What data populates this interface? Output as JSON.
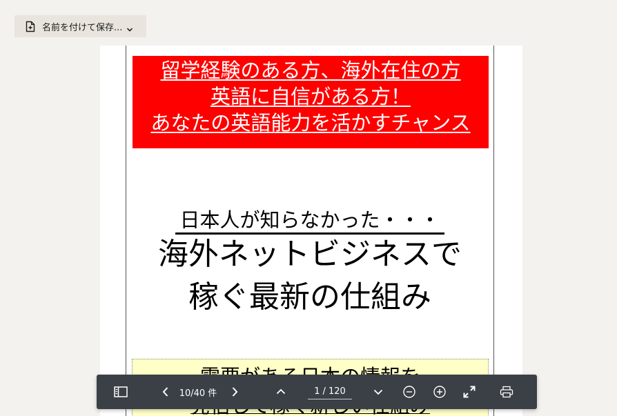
{
  "save_button": {
    "label": "名前を付けて保存...",
    "icon": "document-add-icon",
    "chevron_icon": "chevron-down-icon"
  },
  "document": {
    "red_banner": {
      "lines": [
        "留学経験のある方、海外在住の方",
        "英語に自信がある方！",
        "あなたの英語能力を活かすチャンス"
      ],
      "background": "#ff0000",
      "text_color": "#ffffff"
    },
    "intro": "日本人が知らなかった・・・",
    "headline": [
      "海外ネットビジネスで",
      "稼ぐ最新の仕組み"
    ],
    "yellow_box": {
      "lines": [
        "需要がある日本の情報を",
        "発信して稼ぐ新しい仕組み"
      ],
      "background": "#ffffc8"
    }
  },
  "toolbar": {
    "background": "#3b4046",
    "sidebar_icon": "sidebar-toggle-icon",
    "prev_match_icon": "chevron-left-icon",
    "match_count": "10/40 件",
    "next_match_icon": "chevron-right-icon",
    "prev_page_icon": "chevron-up-icon",
    "page_current": "1",
    "page_total": "/ 120",
    "next_page_icon": "chevron-down-icon",
    "zoom_out_icon": "zoom-out-icon",
    "zoom_in_icon": "zoom-in-icon",
    "fullscreen_icon": "fullscreen-icon",
    "print_icon": "print-icon"
  }
}
